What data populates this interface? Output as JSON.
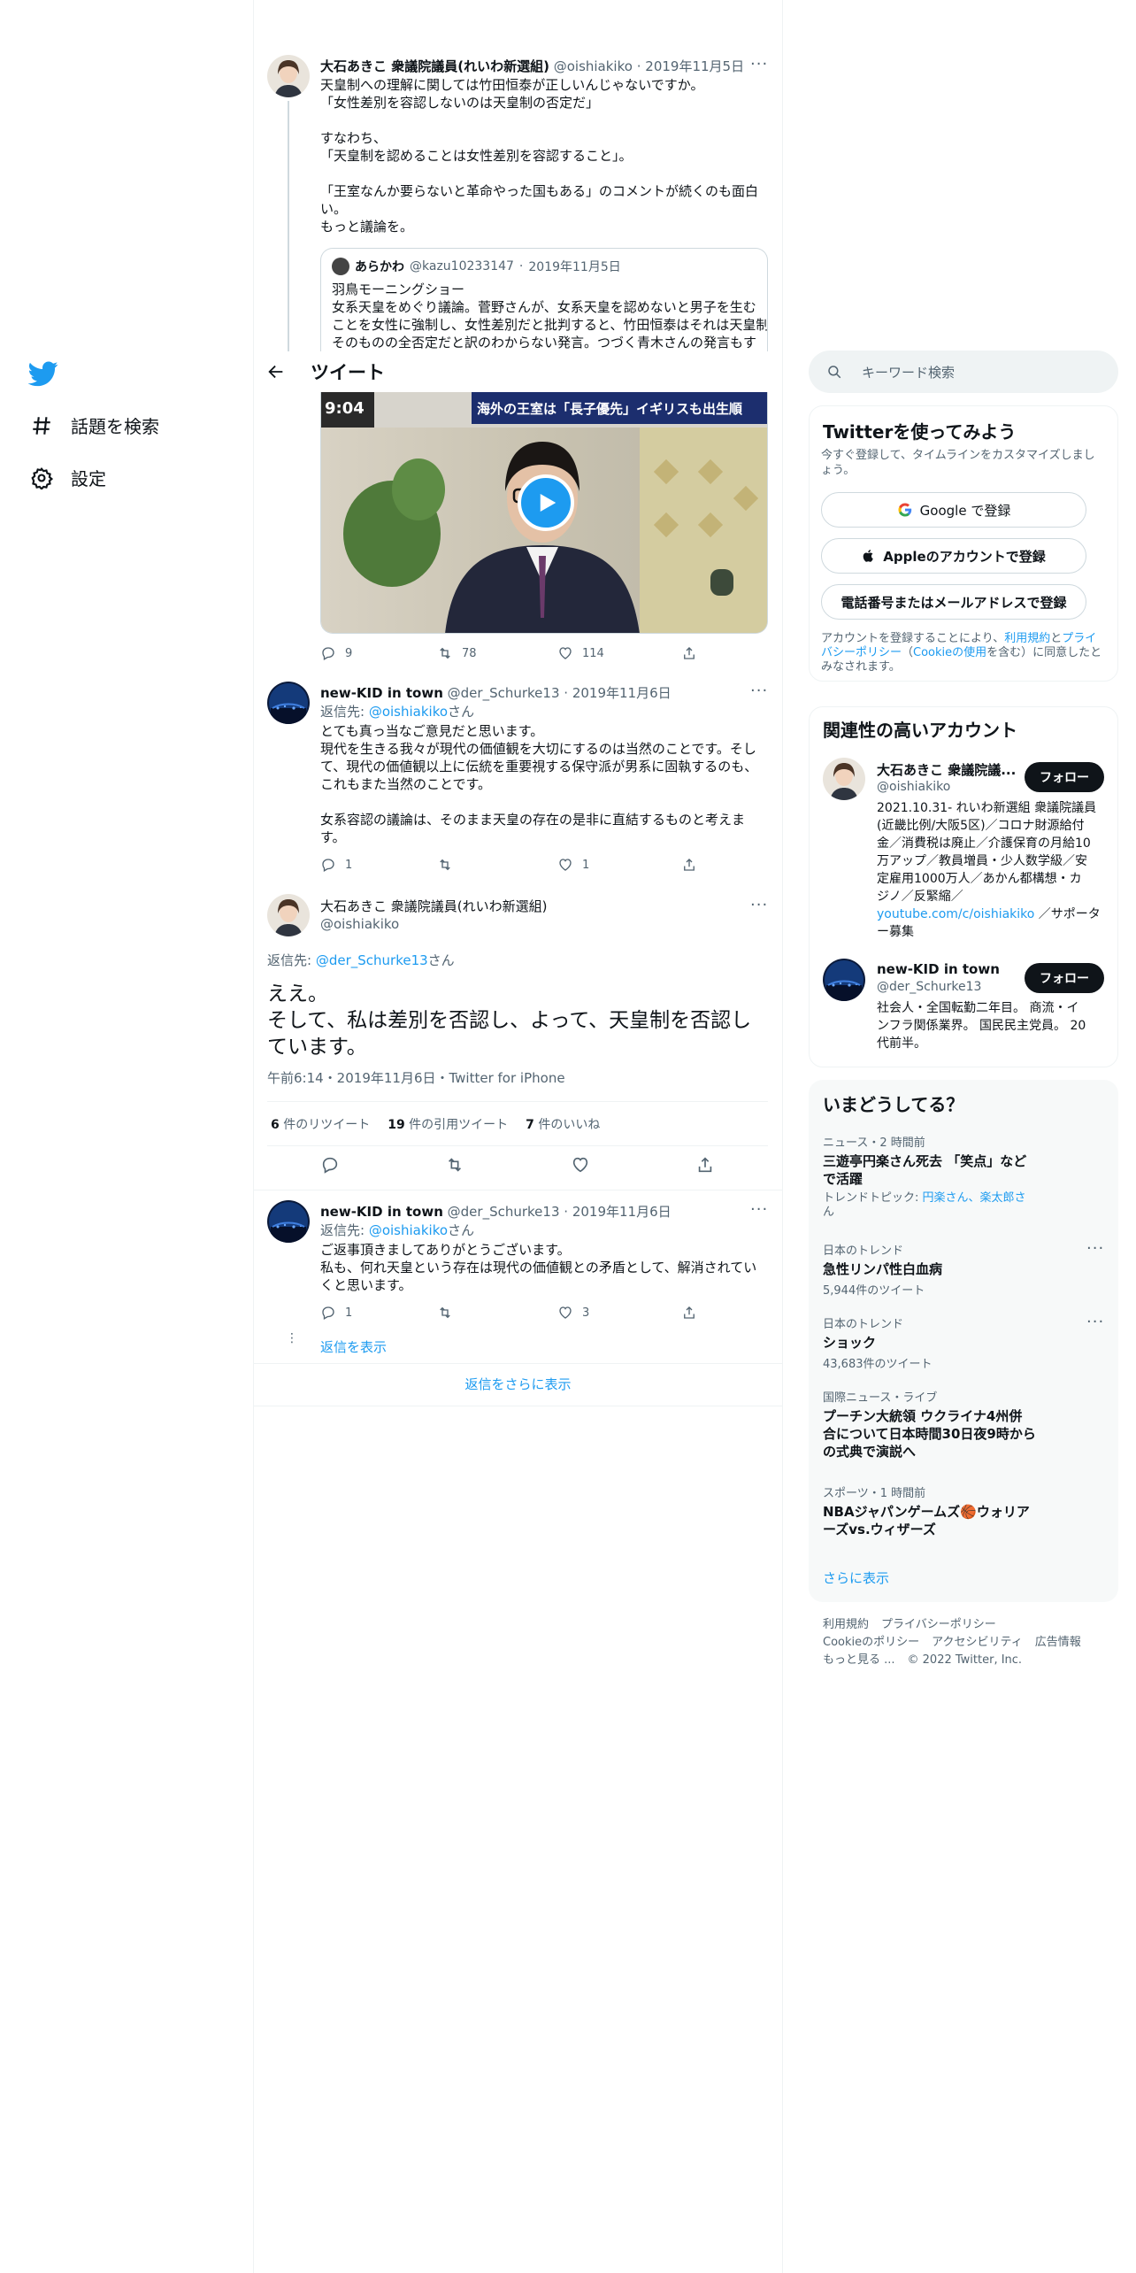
{
  "nav": {
    "items": [
      {
        "label": "話題を検索",
        "icon": "hashtag-icon"
      },
      {
        "label": "設定",
        "icon": "gear-icon"
      }
    ]
  },
  "header": {
    "title": "ツイート"
  },
  "tweet1": {
    "name": "大石あきこ 衆議院議員(れいわ新選組)",
    "handle": "@oishiakiko",
    "date": "2019年11月5日",
    "lines": [
      "天皇制への理解に関しては竹田恒泰が正しいんじゃないですか。",
      "「女性差別を容認しないのは天皇制の否定だ」",
      "",
      "すなわち、",
      "「天皇制を認めることは女性差別を容認すること」。",
      "",
      "「王室なんか要らないと革命やった国もある」のコメントが続くのも面白",
      "い。",
      "もっと議論を。"
    ],
    "quote": {
      "name": "あらかわ",
      "handle": "@kazu10233147",
      "date": "2019年11月5日",
      "lines": [
        "羽鳥モーニングショー",
        "女系天皇をめぐり議論。菅野さんが、女系天皇を認めないと男子を生む",
        "ことを女性に強制し、女性差別だと批判すると、竹田恒泰はそれは天皇制",
        "そのものの全否定だと訳のわからない発言。つづく青木さんの発言もす"
      ]
    },
    "video_caption": "海外の王室は「長子優先」イギリスも出生順",
    "video_time": "9:04",
    "replies": "9",
    "retweets": "78",
    "likes": "114"
  },
  "tweet2": {
    "name": "new-KID in town",
    "handle": "@der_Schurke13",
    "date": "2019年11月6日",
    "reply_prefix": "返信先: ",
    "reply_to": "@oishiakiko",
    "reply_suffix": "さん",
    "lines": [
      "とても真っ当なご意見だと思います。",
      "現代を生きる我々が現代の価値観を大切にするのは当然のことです。そし",
      "て、現代の価値観以上に伝統を重要視する保守派が男系に固執するのも、",
      "これもまた当然のことです。",
      "",
      "女系容認の議論は、そのまま天皇の存在の是非に直結するものと考えま",
      "す。"
    ],
    "replies": "1",
    "retweets": "",
    "likes": "1"
  },
  "main_tweet": {
    "name": "大石あきこ 衆議院議員(れいわ新選組)",
    "handle": "@oishiakiko",
    "reply_prefix": "返信先: ",
    "reply_to": "@der_Schurke13",
    "reply_suffix": "さん",
    "text_lines": [
      "ええ。",
      "そして、私は差別を否認し、よって、天皇制を否認し",
      "ています。"
    ],
    "meta": "午前6:14・2019年11月6日・Twitter for iPhone",
    "retweet_count": "6",
    "retweet_label": " 件のリツイート",
    "quote_count": "19",
    "quote_label": " 件の引用ツイート",
    "like_count": "7",
    "like_label": " 件のいいね"
  },
  "tweet3": {
    "name": "new-KID in town",
    "handle": "@der_Schurke13",
    "date": "2019年11月6日",
    "reply_prefix": "返信先: ",
    "reply_to": "@oishiakiko",
    "reply_suffix": "さん",
    "lines": [
      "ご返事頂きましてありがとうございます。",
      "私も、何れ天皇という存在は現代の価値観との矛盾として、解消されてい",
      "くと思います。"
    ],
    "replies": "1",
    "retweets": "",
    "likes": "3",
    "show_replies": "返信を表示"
  },
  "more_replies": "返信をさらに表示",
  "search": {
    "placeholder": "キーワード検索"
  },
  "signup": {
    "title": "Twitterを使ってみよう",
    "subtitle_lines": [
      "今すぐ登録して、タイムラインをカスタマイズしまし",
      "ょう。"
    ],
    "google": "Google で登録",
    "apple": "Appleのアカウントで登録",
    "phone": "電話番号またはメールアドレスで登録",
    "terms_lines": [
      {
        "pre": "アカウントを登録することにより、",
        "link1": "利用規約",
        "mid": "と",
        "link2": "プライ"
      },
      {
        "link3": "バシーポリシー",
        "mid2": "（",
        "link4": "Cookieの使用",
        "post": "を含む）に同意したと"
      },
      {
        "text": "みなされます。"
      }
    ]
  },
  "related": {
    "title": "関連性の高いアカウント",
    "follow_label": "フォロー",
    "accounts": [
      {
        "name": "大石あきこ 衆議院議...",
        "handle": "@oishiakiko",
        "bio_lines": [
          "2021.10.31- れいわ新選組 衆議院議員",
          "(近畿比例/大阪5区)／コロナ財源給付",
          "金／消費税は廃止／介護保育の月給10",
          "万アップ／教員増員・少人数学級／安",
          "定雇用1000万人／あかん都構想・カ",
          "ジノ／反緊縮／"
        ],
        "bio_link": "youtube.com/c/oishiakiko",
        "bio_after_link": " ／サポータ",
        "bio_last": "ー募集"
      },
      {
        "name": "new-KID in town",
        "handle": "@der_Schurke13",
        "bio_lines": [
          "社会人・全国転勤二年目。 商流・イ",
          "ンフラ関係業界。 国民民主党員。 20",
          "代前半。"
        ]
      }
    ]
  },
  "trends": {
    "title": "いまどうしてる？",
    "items": [
      {
        "category": "ニュース・2 時間前",
        "name_lines": [
          "三遊亭円楽さん死去 「笑点」など",
          "で活躍"
        ],
        "sub_pre": "トレンドトピック: ",
        "sub_link_lines": [
          "円楽さん、楽太郎さ",
          "ん"
        ]
      },
      {
        "category": "日本のトレンド",
        "name_lines": [
          "急性リンパ性白血病"
        ],
        "sub": "5,944件のツイート"
      },
      {
        "category": "日本のトレンド",
        "name_lines": [
          "ショック"
        ],
        "sub": "43,683件のツイート"
      },
      {
        "category": "国際ニュース・ライブ",
        "name_lines": [
          "プーチン大統領 ウクライナ4州併",
          "合について日本時間30日夜9時から",
          "の式典で演説へ"
        ]
      },
      {
        "category": "スポーツ・1 時間前",
        "name_lines": [
          "NBAジャパンゲームズ🏀ウォリア",
          "ーズvs.ウィザーズ"
        ]
      }
    ],
    "show_more": "さらに表示"
  },
  "footer": {
    "line1": [
      "利用規約",
      "プライバシーポリシー"
    ],
    "line2": [
      "Cookieのポリシー",
      "アクセシビリティ",
      "広告情報"
    ],
    "more": "もっと見る ...",
    "copyright": "© 2022 Twitter, Inc."
  },
  "colors": {
    "accent": "#1d9bf0",
    "text": "#0f1419",
    "muted": "#536471",
    "border": "#eff3f4"
  }
}
